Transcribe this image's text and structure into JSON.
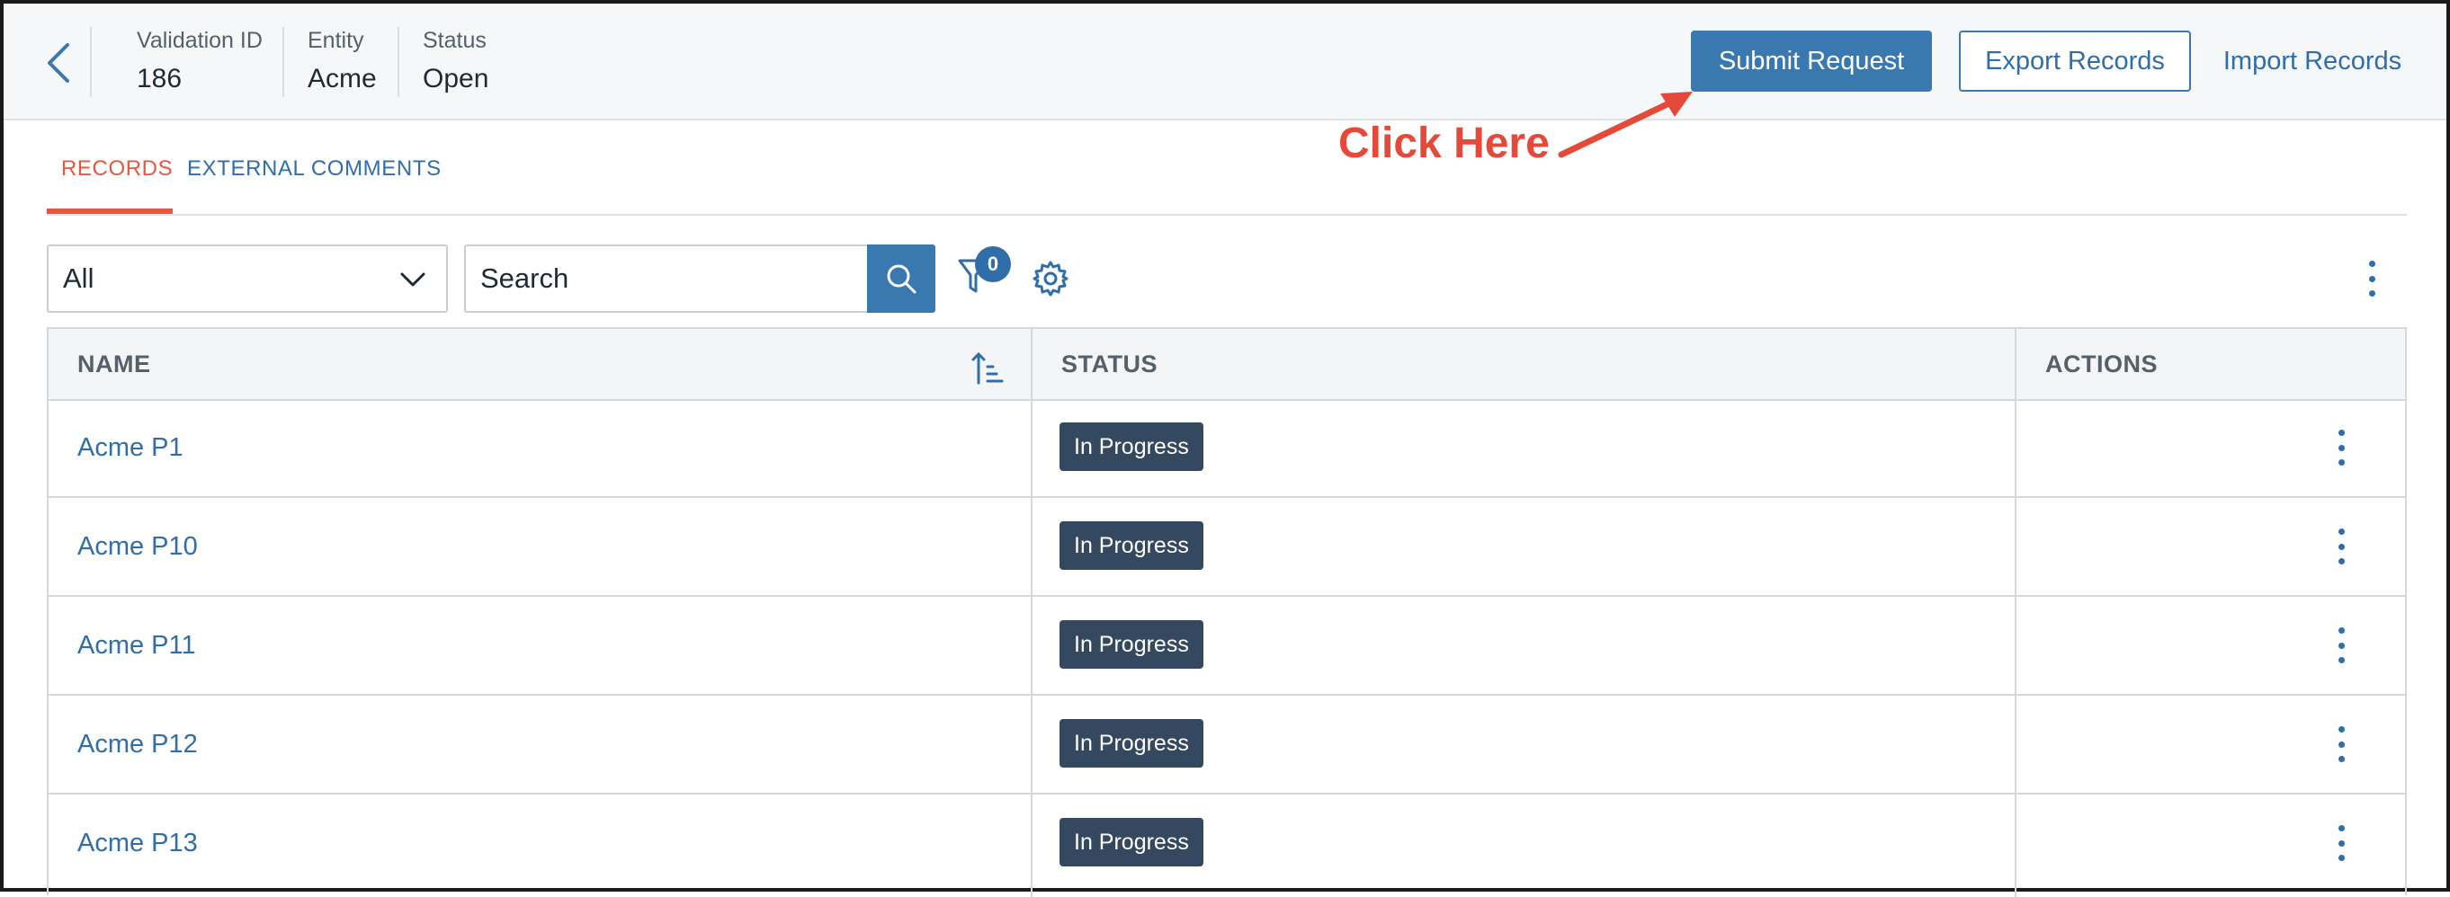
{
  "header": {
    "meta": [
      {
        "label": "Validation ID",
        "value": "186"
      },
      {
        "label": "Entity",
        "value": "Acme"
      },
      {
        "label": "Status",
        "value": "Open"
      }
    ],
    "submit_label": "Submit Request",
    "export_label": "Export Records",
    "import_label": "Import Records"
  },
  "annotation": {
    "text": "Click Here",
    "color": "#e5493a"
  },
  "tabs": [
    {
      "label": "RECORDS",
      "active": true
    },
    {
      "label": "EXTERNAL COMMENTS",
      "active": false
    }
  ],
  "toolbar": {
    "filter_select": "All",
    "search_placeholder": "Search",
    "filter_count": "0"
  },
  "table": {
    "columns": [
      "NAME",
      "STATUS",
      "ACTIONS"
    ],
    "rows": [
      {
        "name": "Acme P1",
        "status": "In Progress"
      },
      {
        "name": "Acme P10",
        "status": "In Progress"
      },
      {
        "name": "Acme P11",
        "status": "In Progress"
      },
      {
        "name": "Acme P12",
        "status": "In Progress"
      },
      {
        "name": "Acme P13",
        "status": "In Progress"
      }
    ]
  },
  "colors": {
    "accent": "#3a78b0",
    "tab_active": "#e5583f",
    "badge": "#34485f"
  },
  "icons": [
    "chevron-left-icon",
    "chevron-down-icon",
    "search-icon",
    "filter-icon",
    "gear-icon",
    "kebab-icon",
    "sort-ascending-icon"
  ]
}
